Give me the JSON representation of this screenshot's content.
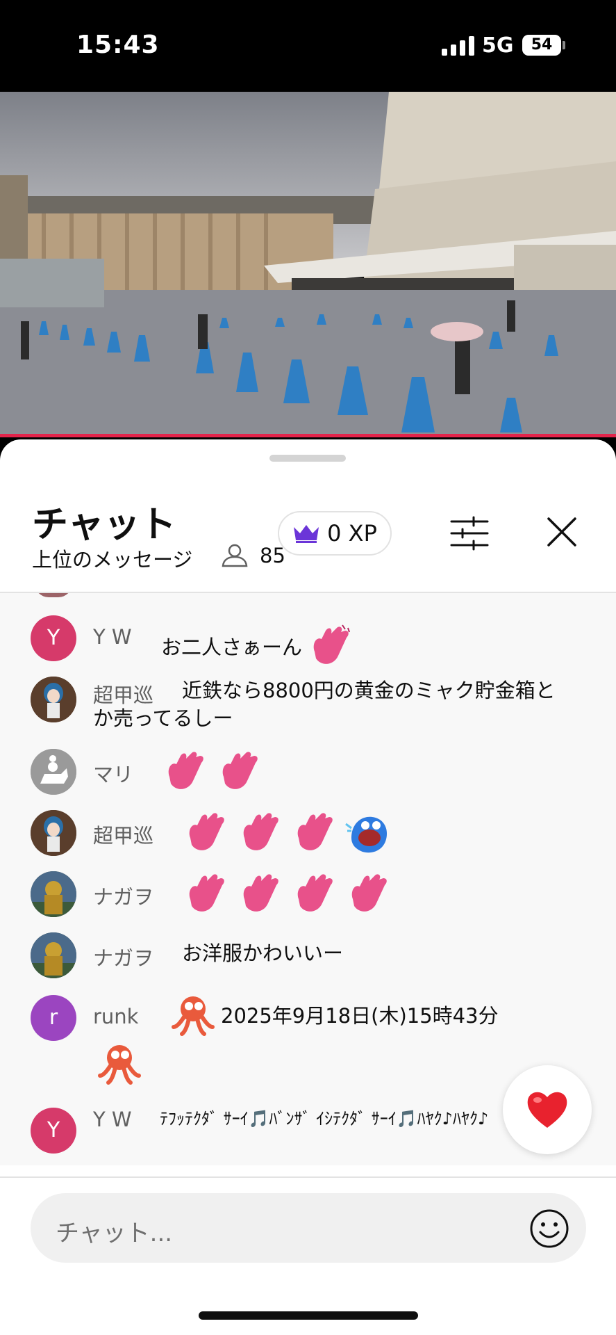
{
  "status_bar": {
    "time": "15:43",
    "network": "5G",
    "battery": "54"
  },
  "chat": {
    "title": "チャット",
    "subtitle": "上位のメッセージ",
    "viewer_count": "85",
    "xp_label": "0 XP",
    "accent_color": "#e3244b"
  },
  "messages": [
    {
      "author": "Y W",
      "avatar_letter": "Y",
      "avatar_color": "#d63a6a",
      "text": "お二人さぁーん",
      "emojis": [
        "waving-hand"
      ]
    },
    {
      "author": "超甲巡",
      "avatar_letter": "",
      "text": "近鉄なら8800円の黄金のミャク貯金箱とか売ってるしー",
      "emojis": []
    },
    {
      "author": "マリ",
      "avatar_letter": "",
      "text": "",
      "emojis": [
        "waving-hand",
        "waving-hand"
      ]
    },
    {
      "author": "超甲巡",
      "avatar_letter": "",
      "text": "",
      "emojis": [
        "waving-hand",
        "waving-hand",
        "waving-hand",
        "laughing-face"
      ]
    },
    {
      "author": "ナガヲ",
      "avatar_letter": "",
      "text": "",
      "emojis": [
        "waving-hand",
        "waving-hand",
        "waving-hand",
        "waving-hand"
      ]
    },
    {
      "author": "ナガヲ",
      "avatar_letter": "",
      "text": "お洋服かわいいー",
      "emojis": []
    },
    {
      "author": "runk",
      "avatar_letter": "r",
      "avatar_color": "#9b45c0",
      "text": "2025年9月18日(木)15時43分",
      "emojis": [
        "octopus",
        "octopus"
      ]
    },
    {
      "author": "Y W",
      "avatar_letter": "Y",
      "avatar_color": "#d63a6a",
      "text": "ﾃﾌｯﾃｸﾀﾞ ｻｰｲ🎵ﾊﾞﾝｻﾞ ｲｼﾃｸﾀﾞ ｻｰｲ🎵ﾊﾔｸ♪ﾊﾔｸ♪",
      "emojis": []
    }
  ],
  "input": {
    "placeholder": "チャット..."
  }
}
